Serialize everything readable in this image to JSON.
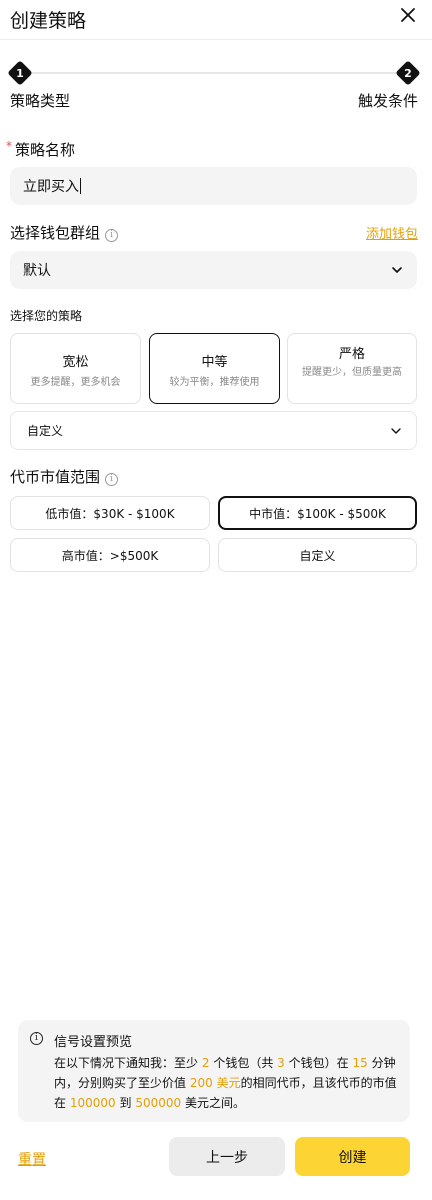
{
  "header": {
    "title": "创建策略"
  },
  "stepper": {
    "steps": [
      {
        "number": "1",
        "label": "策略类型"
      },
      {
        "number": "2",
        "label": "触发条件"
      }
    ]
  },
  "strategy_name": {
    "label": "策略名称",
    "required_mark": "*",
    "value": "立即买入"
  },
  "wallet_group": {
    "label": "选择钱包群组",
    "info_icon": "info-icon",
    "add_link": "添加钱包",
    "selected": "默认"
  },
  "strategy": {
    "label": "选择您的策略",
    "options": [
      {
        "title": "宽松",
        "desc": "更多提醒，更多机会"
      },
      {
        "title": "中等",
        "desc": "较为平衡，推荐使用"
      },
      {
        "title": "严格",
        "desc": "提醒更少，但质量更高"
      }
    ],
    "selected_index": 1,
    "custom_label": "自定义"
  },
  "market_cap": {
    "label": "代币市值范围",
    "options": [
      {
        "label": "低市值：$30K - $100K"
      },
      {
        "label": "中市值：$100K - $500K"
      },
      {
        "label": "高市值：>$500K"
      },
      {
        "label": "自定义"
      }
    ],
    "selected_index": 1
  },
  "preview": {
    "title": "信号设置预览",
    "t1": "在以下情况下通知我：至少",
    "wallets_min": "2",
    "t2": "个钱包（共",
    "wallets_total": "3",
    "t3": "个钱包）在",
    "minutes": "15",
    "t4": "分钟内，分别购买了至少价值",
    "amount": "200 美元",
    "t5": "的相同代币，且该代币的市值在",
    "cap_min": "100000",
    "t6": "到",
    "cap_max": "500000",
    "t7": "美元之间。"
  },
  "footer": {
    "reset": "重置",
    "prev": "上一步",
    "create": "创建"
  },
  "colors": {
    "accent": "#fcd535",
    "link": "#e3a008",
    "required": "#e5484d"
  }
}
